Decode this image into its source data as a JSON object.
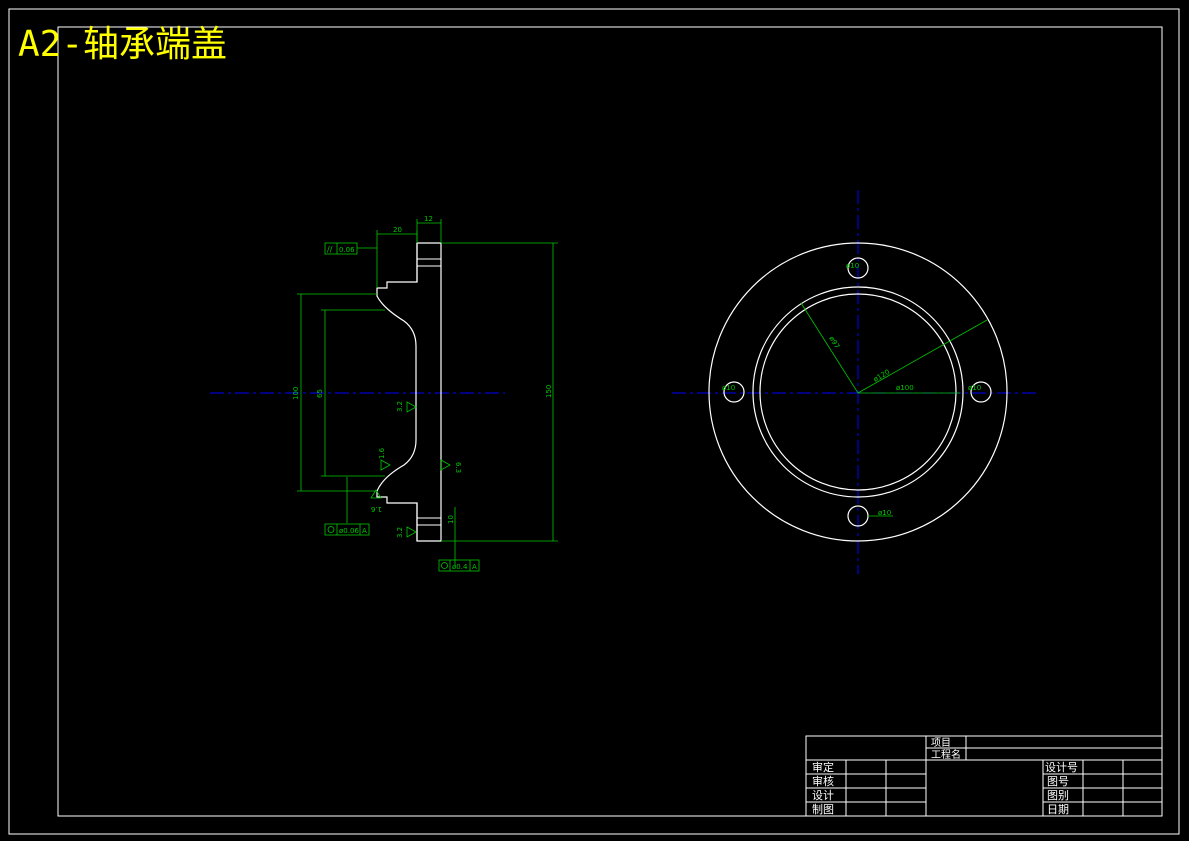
{
  "title": "A2-轴承端盖",
  "colors": {
    "background": "#000000",
    "outline": "#ffffff",
    "dimension": "#00c800",
    "centerline": "#0000ff",
    "title": "#ffff00"
  },
  "section_view": {
    "dims": {
      "top_20": "20",
      "top_12": "12",
      "dia_100": "100",
      "dia_65": "65",
      "dia_150": "150",
      "side_10": "10"
    },
    "tolerances": {
      "parallel_value": "0.06",
      "runout_value": "ø0.06",
      "runout_datum": "A",
      "position_value": "ø0.4",
      "position_datum": "A"
    },
    "roughness": [
      "3.2",
      "1.6",
      "6.3",
      "1.6",
      "3.2"
    ]
  },
  "front_view": {
    "dims": {
      "hole_top": "ø10",
      "hole_left": "ø10",
      "hole_right": "ø10",
      "hole_bottom": "ø10",
      "inner_dia": "ø97",
      "bolt_circle": "ø120",
      "dia_100": "ø100"
    }
  },
  "title_block": {
    "project_label": "项目",
    "project_name_label": "工程名",
    "left_labels": [
      "审定",
      "审核",
      "设计",
      "制图"
    ],
    "right_labels": [
      "设计号",
      "图号",
      "图别",
      "日期"
    ]
  }
}
